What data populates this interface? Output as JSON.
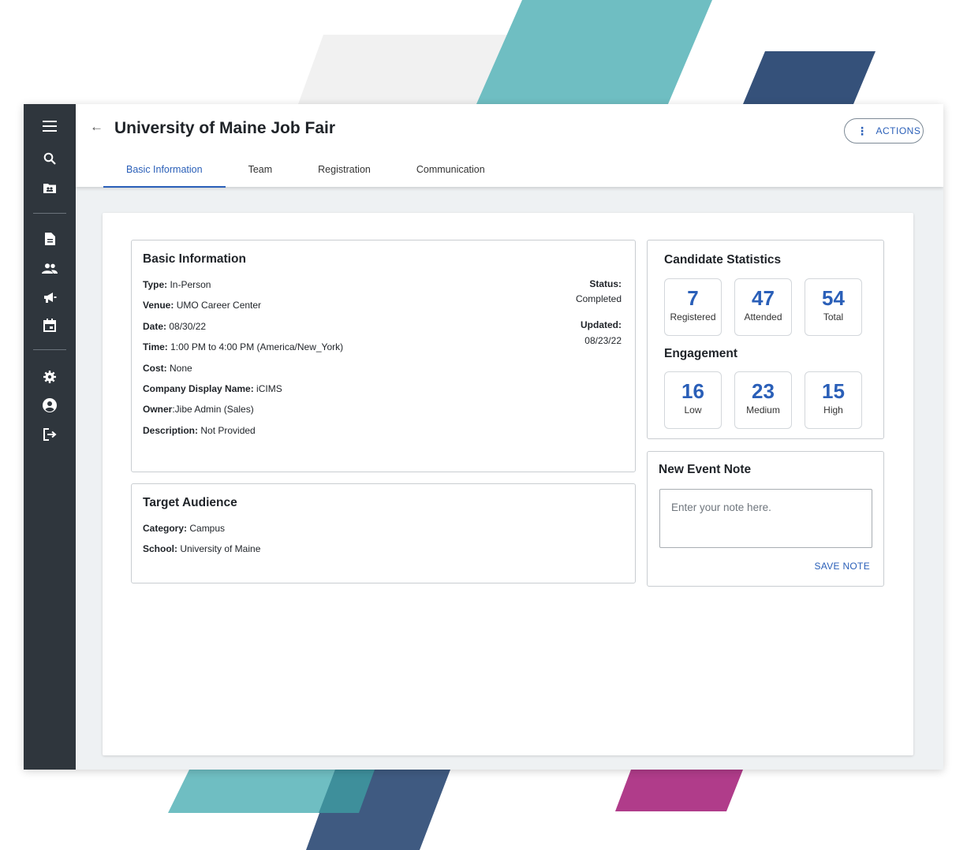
{
  "page": {
    "title": "University of Maine Job Fair",
    "actions_label": "ACTIONS"
  },
  "tabs": [
    {
      "label": "Basic Information",
      "active": true
    },
    {
      "label": "Team",
      "active": false
    },
    {
      "label": "Registration",
      "active": false
    },
    {
      "label": "Communication",
      "active": false
    }
  ],
  "sidebar": {
    "icons": [
      "menu-icon",
      "search-icon",
      "contacts-folder-icon",
      "document-icon",
      "people-icon",
      "megaphone-icon",
      "calendar-icon",
      "gear-icon",
      "account-circle-icon",
      "logout-icon"
    ]
  },
  "basic_info": {
    "title": "Basic Information",
    "fields": [
      {
        "label": "Type:",
        "value": " In-Person"
      },
      {
        "label": "Venue:",
        "value": " UMO Career Center"
      },
      {
        "label": "Date:",
        "value": " 08/30/22"
      },
      {
        "label": "Time:",
        "value": " 1:00 PM to 4:00 PM (America/New_York)"
      },
      {
        "label": "Cost:",
        "value": " None"
      },
      {
        "label": "Company Display Name:",
        "value": " iCIMS"
      },
      {
        "label": "Owner",
        "value": ":Jibe Admin (Sales)"
      },
      {
        "label": "Description:",
        "value": " Not Provided"
      }
    ],
    "status_label": "Status:",
    "status_value": "Completed",
    "updated_label": "Updated:",
    "updated_value": "08/23/22"
  },
  "target_audience": {
    "title": "Target Audience",
    "fields": [
      {
        "label": "Category:",
        "value": " Campus"
      },
      {
        "label": "School:",
        "value": " University of Maine"
      }
    ]
  },
  "candidate_stats": {
    "title": "Candidate Statistics",
    "stats": [
      {
        "value": "7",
        "label": "Registered"
      },
      {
        "value": "47",
        "label": "Attended"
      },
      {
        "value": "54",
        "label": "Total"
      }
    ],
    "engagement_title": "Engagement",
    "engagement": [
      {
        "value": "16",
        "label": "Low"
      },
      {
        "value": "23",
        "label": "Medium"
      },
      {
        "value": "15",
        "label": "High"
      }
    ]
  },
  "event_note": {
    "title": "New Event Note",
    "placeholder": "Enter your note here.",
    "save_label": "SAVE NOTE"
  },
  "colors": {
    "accent": "#2a5fb8",
    "sidebar": "#2f363d",
    "teal": "#6fbec2",
    "navy": "#35517a",
    "magenta": "#b03c8a",
    "light_gray": "#f1f1f1"
  }
}
